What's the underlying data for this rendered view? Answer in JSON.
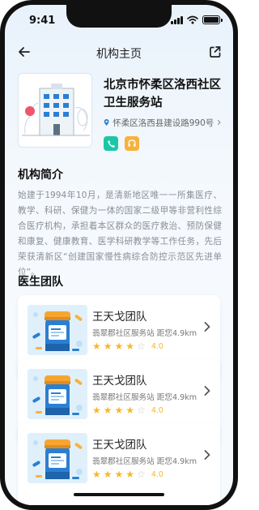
{
  "status_bar": {
    "time": "9:41"
  },
  "nav": {
    "title": "机构主页"
  },
  "org": {
    "name": "北京市怀柔区洛西社区卫生服务站",
    "address": "怀柔区洛西县建设路990号"
  },
  "intro": {
    "title": "机构简介",
    "text": "始建于1994年10月，是清新地区唯一一所集医疗、教学、科研、保健为一体的国家二级甲等非营利性综合医疗机构，承担着本区群众的医疗救治、预防保健和康复、健康教育、医学科研教学等工作任务，先后荣获清新区“创建国家慢性病综合防控示范区先进单位”。"
  },
  "team": {
    "title": "医生团队",
    "cards": [
      {
        "name": "王天戈团队",
        "sub": "翡翠郡社区服务站 距您4.9km",
        "rating": "4.0"
      },
      {
        "name": "王天戈团队",
        "sub": "翡翠郡社区服务站 距您4.9km",
        "rating": "4.0"
      },
      {
        "name": "王天戈团队",
        "sub": "翡翠郡社区服务站 距您4.9km",
        "rating": "4.0"
      }
    ]
  },
  "icons": {
    "back": "arrow-left-icon",
    "share": "share-icon",
    "location": "location-pin-icon",
    "address_chevron": "chevron-right-icon",
    "phone": "phone-icon",
    "service": "headset-icon",
    "card_chevron": "chevron-right-icon"
  },
  "colors": {
    "accent_blue": "#2a7fd4",
    "phone_green": "#1cc7a7",
    "service_orange": "#f7b23e",
    "star_gold": "#f5b82e"
  }
}
